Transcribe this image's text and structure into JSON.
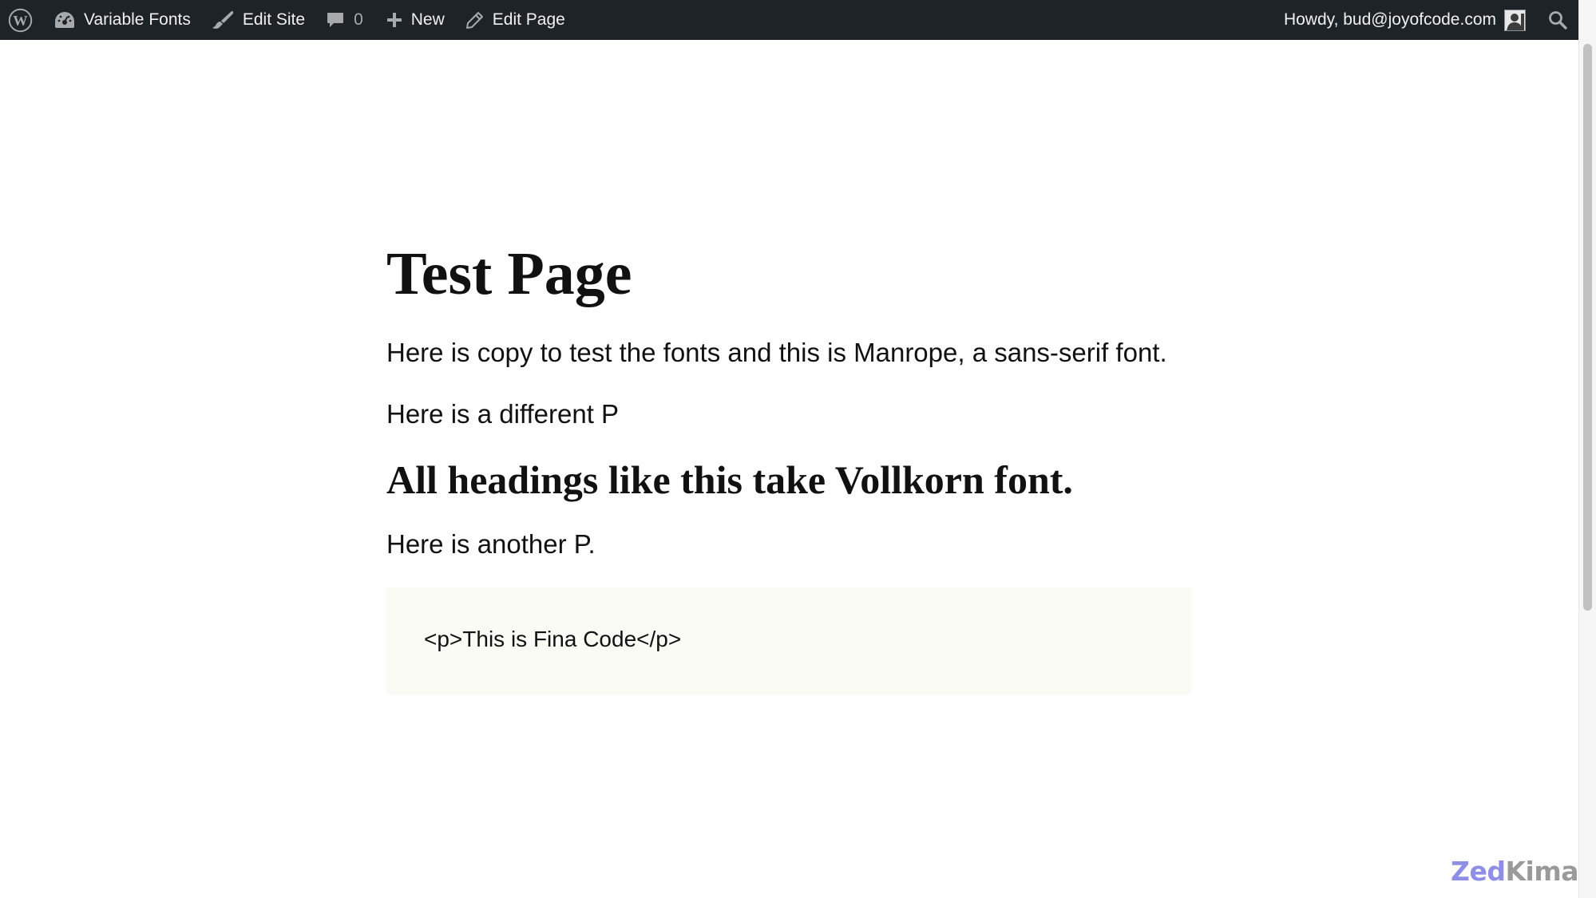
{
  "admin_bar": {
    "logo_icon": "wordpress-logo-icon",
    "site_name": "Variable Fonts",
    "site_icon": "dashboard-icon",
    "edit_site_label": "Edit Site",
    "edit_site_icon": "brush-icon",
    "comments_count": "0",
    "comments_icon": "comment-bubble-icon",
    "new_label": "New",
    "new_icon": "plus-icon",
    "edit_page_label": "Edit Page",
    "edit_page_icon": "pencil-icon",
    "greeting": "Howdy, bud@joyofcode.com",
    "avatar_icon": "user-avatar-icon",
    "search_icon": "search-icon",
    "background_color": "#1d2327",
    "text_color": "#f0f0f1"
  },
  "page": {
    "title": "Test Page",
    "paragraph_1": "Here is copy to test the fonts and this is Manrope, a sans-serif font.",
    "paragraph_2": "Here is a different P",
    "heading_2": "All headings like this take Vollkorn font.",
    "paragraph_3": "Here is another P.",
    "code_text": "<p>This is Fina Code</p>",
    "code_background": "#fbfbf5"
  },
  "watermark": {
    "part_1": "Zed",
    "part_2": "Kima",
    "color_1": "#8e8ee6",
    "color_2": "#9a9a9a"
  }
}
